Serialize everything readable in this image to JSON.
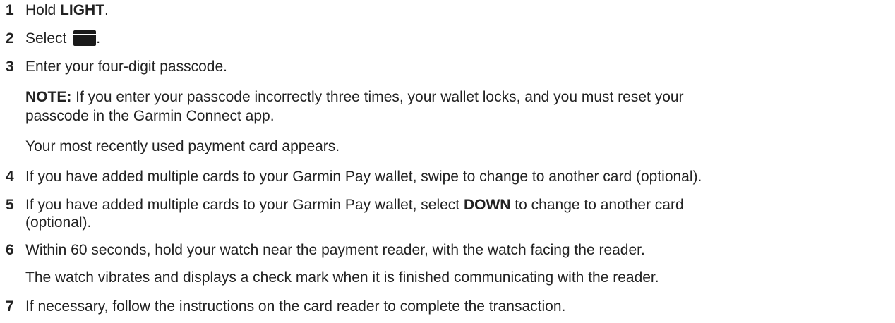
{
  "steps": [
    {
      "num": "1",
      "pre": "Hold ",
      "bold": "LIGHT",
      "post": "."
    },
    {
      "num": "2",
      "pre": "Select ",
      "icon": "card-icon",
      "post": "."
    },
    {
      "num": "3",
      "text": "Enter your four-digit passcode."
    },
    {
      "num": "4",
      "text": "If you have added multiple cards to your Garmin Pay wallet, swipe to change to another card (optional)."
    },
    {
      "num": "5",
      "pre": "If you have added multiple cards to your Garmin Pay wallet, select ",
      "bold": "DOWN",
      "post": " to change to another card",
      "line2": "(optional)."
    },
    {
      "num": "6",
      "text": "Within 60 seconds, hold your watch near the payment reader, with the watch facing the reader."
    },
    {
      "num": "7",
      "text": "If necessary, follow the instructions on the card reader to complete the transaction."
    }
  ],
  "note": {
    "label": "NOTE:",
    "line1": " If you enter your passcode incorrectly three times, your wallet locks, and you must reset your",
    "line2": "passcode in the Garmin Connect app."
  },
  "step3_result": "Your most recently used payment card appears.",
  "step6_result": "The watch vibrates and displays a check mark when it is finished communicating with the reader."
}
